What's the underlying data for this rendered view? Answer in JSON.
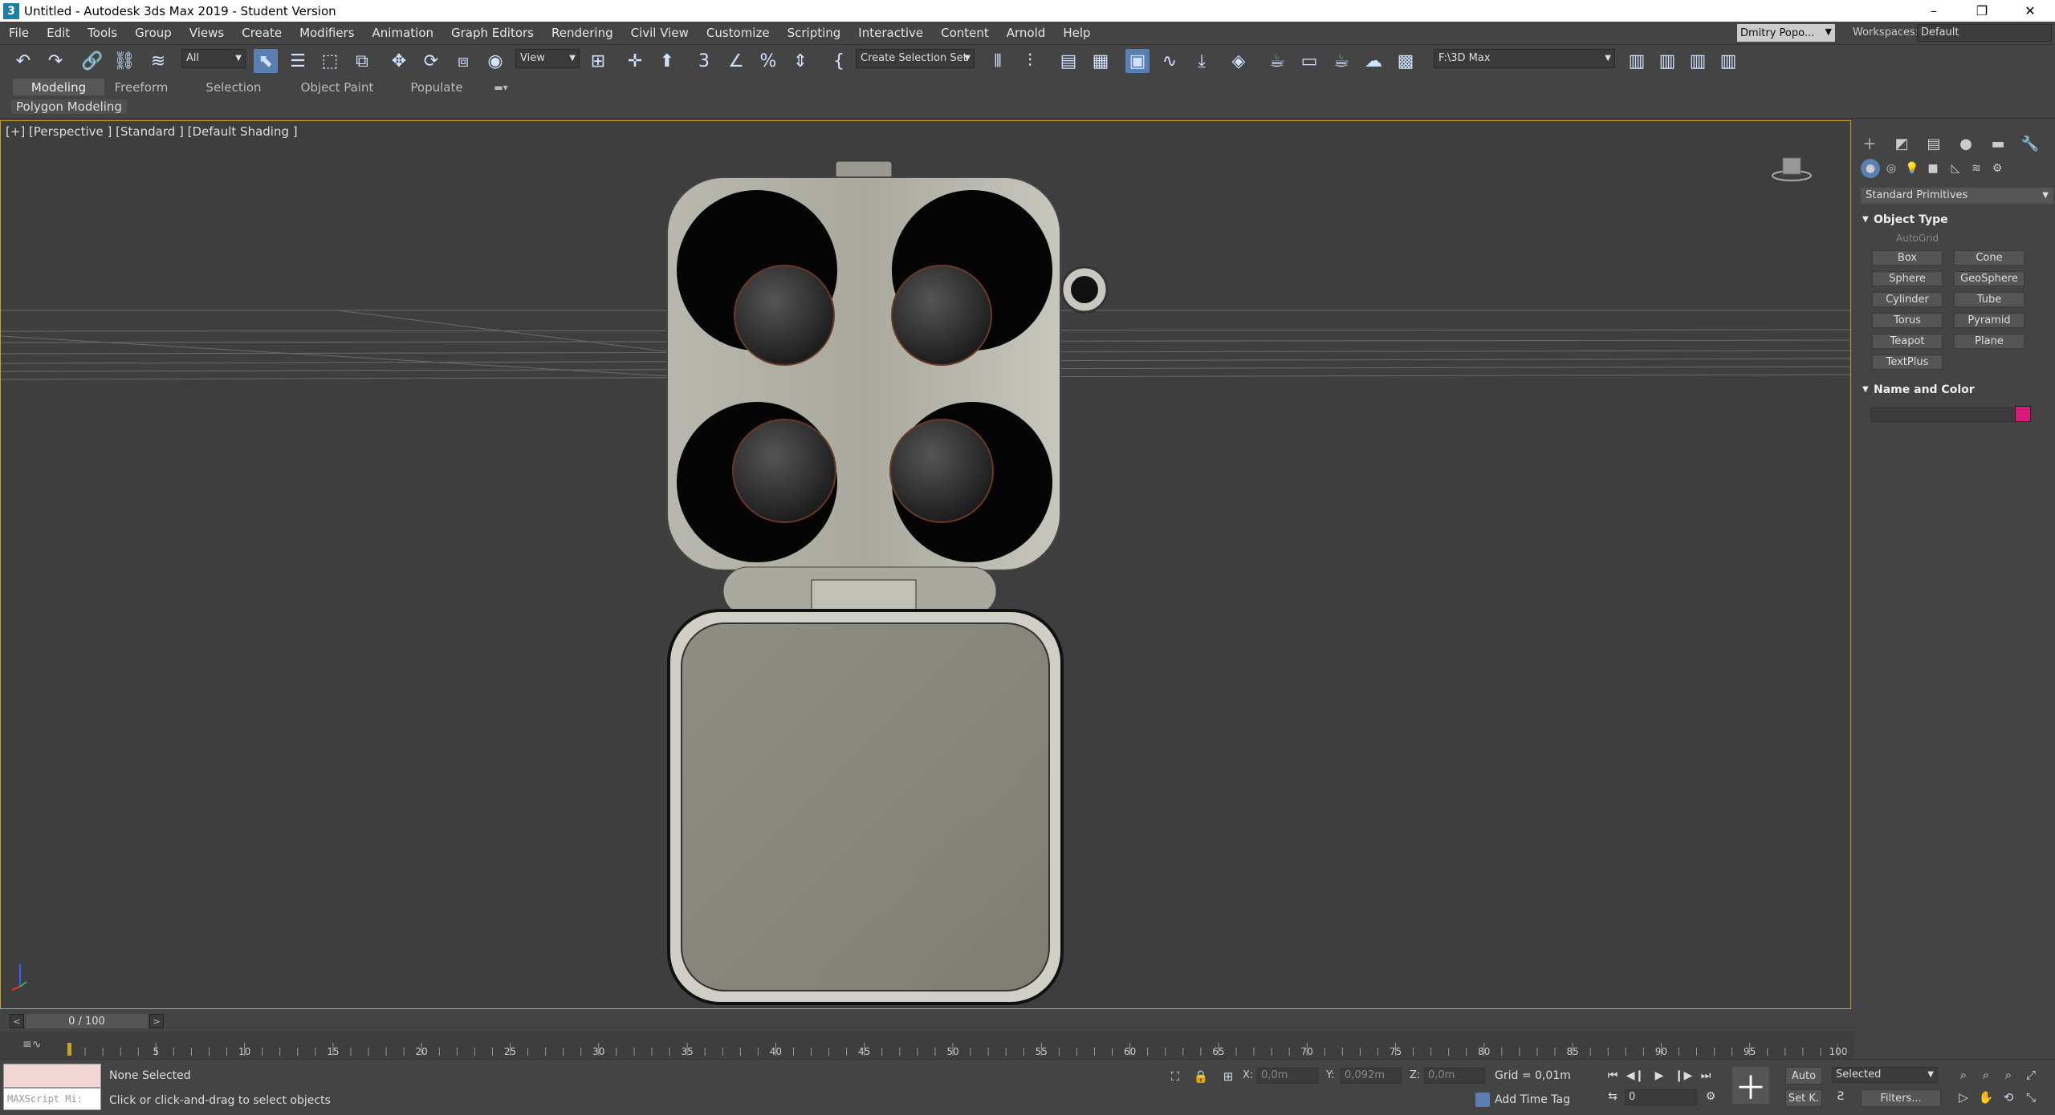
{
  "window": {
    "title": "Untitled - Autodesk 3ds Max 2019 - Student Version",
    "logo": "3",
    "controls": {
      "minimize": "–",
      "maximize": "❐",
      "close": "✕"
    }
  },
  "menu": [
    "File",
    "Edit",
    "Tools",
    "Group",
    "Views",
    "Create",
    "Modifiers",
    "Animation",
    "Graph Editors",
    "Rendering",
    "Civil View",
    "Customize",
    "Scripting",
    "Interactive",
    "Content",
    "Arnold",
    "Help"
  ],
  "account": {
    "user": "Dmitry Popo...",
    "workspaces_label": "Workspaces:",
    "workspace": "Default"
  },
  "toolbar": {
    "filter": "All",
    "ref_coord": "View",
    "selection_set": "Create Selection Set",
    "project_path": "F:\\3D Max"
  },
  "ribbon": {
    "tabs": [
      "Modeling",
      "Freeform",
      "Selection",
      "Object Paint",
      "Populate"
    ],
    "active_tab": "Modeling",
    "panel_label": "Polygon Modeling"
  },
  "viewport": {
    "label": "[+] [Perspective ] [Standard ] [Default Shading ]"
  },
  "command_panel": {
    "category": "Standard Primitives",
    "object_type_title": "Object Type",
    "autogrid": "AutoGrid",
    "primitives": [
      "Box",
      "Cone",
      "Sphere",
      "GeoSphere",
      "Cylinder",
      "Tube",
      "Torus",
      "Pyramid",
      "Teapot",
      "Plane",
      "TextPlus"
    ],
    "name_color_title": "Name and Color",
    "object_color": "#d81b7a"
  },
  "timeline": {
    "frame_display": "0 / 100",
    "ticks": [
      "5",
      "10",
      "15",
      "20",
      "25",
      "30",
      "35",
      "40",
      "45",
      "50",
      "55",
      "60",
      "65",
      "70",
      "75",
      "80",
      "85",
      "90",
      "95",
      "100"
    ]
  },
  "status": {
    "maxscript_placeholder": "MAXScript Mi:",
    "selection": "None Selected",
    "prompt": "Click or click-and-drag to select objects",
    "x_label": "X:",
    "x_value": "0,0m",
    "y_label": "Y:",
    "y_value": "0,092m",
    "z_label": "Z:",
    "z_value": "0,0m",
    "grid": "Grid = 0,01m",
    "time_tag": "Add Time Tag",
    "frame": "0",
    "auto_key": "Auto",
    "set_key": "Set K.",
    "key_filter": "Selected",
    "filters": "Filters..."
  }
}
